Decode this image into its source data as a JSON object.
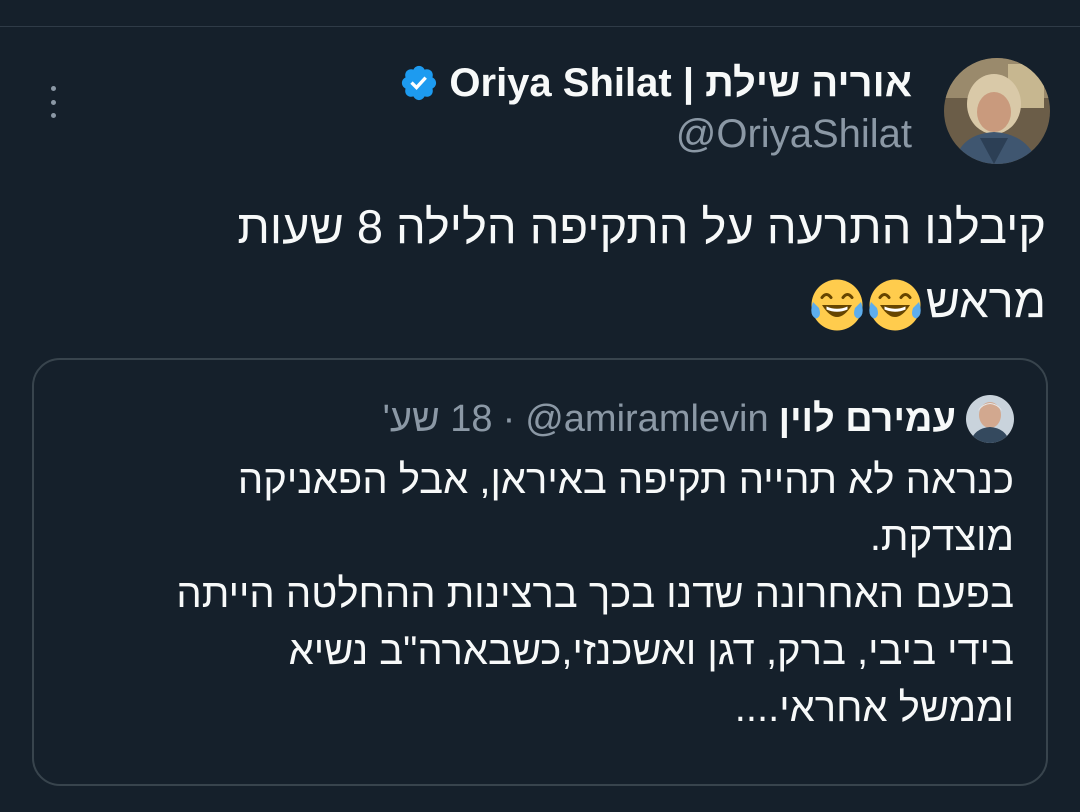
{
  "colors": {
    "background": "#15202b",
    "text_primary": "#f7f9f9",
    "text_secondary": "#8b98a5",
    "border": "#38444d",
    "verified_badge": "#1d9bf0"
  },
  "header": {
    "more_icon": "more-vertical-icon",
    "avatar_icon": "user-avatar",
    "display_name": "אוריה שילת | Oriya Shilat",
    "verified_icon": "verified-badge-icon",
    "handle": "@OriyaShilat"
  },
  "tweet": {
    "lines": [
      "קיבלנו התרעה על התקיפה הלילה 8 שעות",
      "מראש"
    ],
    "emojis": [
      "😂",
      "😂"
    ]
  },
  "quote": {
    "avatar_icon": "user-avatar",
    "display_name": "עמירם לוין",
    "handle": "@amiramlevin",
    "separator": "·",
    "time": "18 שע'",
    "lines": [
      "כנראה לא תהייה תקיפה באיראן, אבל הפאניקה",
      "מוצדקת.",
      "בפעם האחרונה שדנו בכך ברצינות ההחלטה הייתה",
      "בידי ביבי, ברק,  דגן  ואשכנזי,כשבארה\"ב נשיא",
      "וממשל אחראי...."
    ]
  }
}
